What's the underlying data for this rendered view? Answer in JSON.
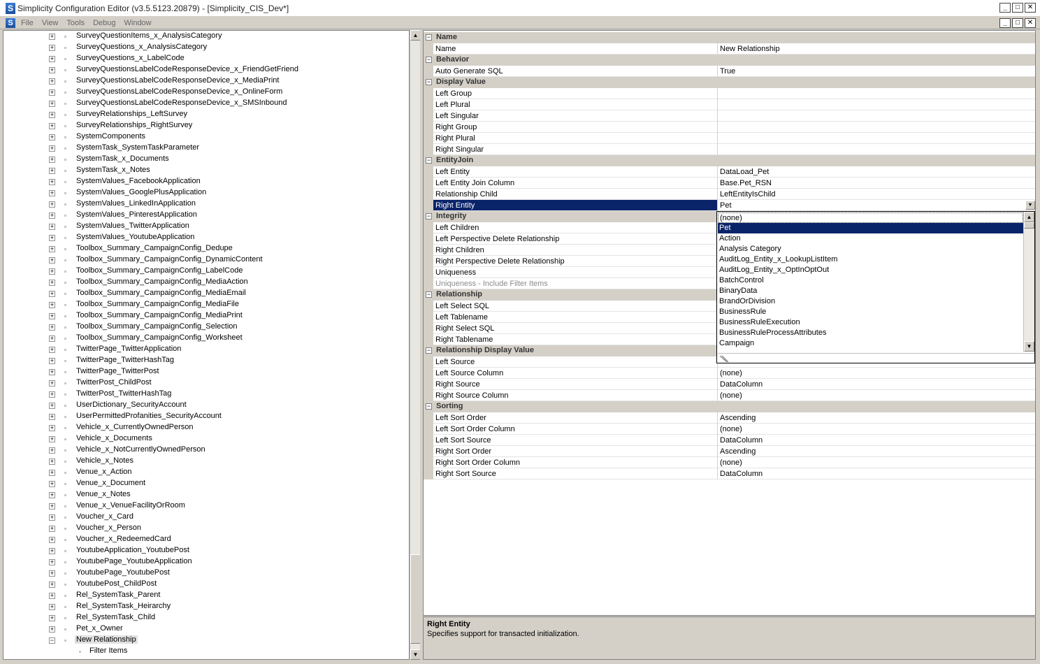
{
  "window": {
    "title": "Simplicity Configuration Editor (v3.5.5123.20879) - [Simplicity_CIS_Dev*]",
    "app_icon_letter": "S",
    "buttons": {
      "minimize": "_",
      "restore": "□",
      "close": "✕"
    }
  },
  "menubar": {
    "items": [
      "File",
      "View",
      "Tools",
      "Debug",
      "Window"
    ]
  },
  "tree": {
    "items": [
      "SurveyQuestionItems_x_AnalysisCategory",
      "SurveyQuestions_x_AnalysisCategory",
      "SurveyQuestions_x_LabelCode",
      "SurveyQuestionsLabelCodeResponseDevice_x_FriendGetFriend",
      "SurveyQuestionsLabelCodeResponseDevice_x_MediaPrint",
      "SurveyQuestionsLabelCodeResponseDevice_x_OnlineForm",
      "SurveyQuestionsLabelCodeResponseDevice_x_SMSInbound",
      "SurveyRelationships_LeftSurvey",
      "SurveyRelationships_RightSurvey",
      "SystemComponents",
      "SystemTask_SystemTaskParameter",
      "SystemTask_x_Documents",
      "SystemTask_x_Notes",
      "SystemValues_FacebookApplication",
      "SystemValues_GooglePlusApplication",
      "SystemValues_LinkedInApplication",
      "SystemValues_PinterestApplication",
      "SystemValues_TwitterApplication",
      "SystemValues_YoutubeApplication",
      "Toolbox_Summary_CampaignConfig_Dedupe",
      "Toolbox_Summary_CampaignConfig_DynamicContent",
      "Toolbox_Summary_CampaignConfig_LabelCode",
      "Toolbox_Summary_CampaignConfig_MediaAction",
      "Toolbox_Summary_CampaignConfig_MediaEmail",
      "Toolbox_Summary_CampaignConfig_MediaFile",
      "Toolbox_Summary_CampaignConfig_MediaPrint",
      "Toolbox_Summary_CampaignConfig_Selection",
      "Toolbox_Summary_CampaignConfig_Worksheet",
      "TwitterPage_TwitterApplication",
      "TwitterPage_TwitterHashTag",
      "TwitterPage_TwitterPost",
      "TwitterPost_ChildPost",
      "TwitterPost_TwitterHashTag",
      "UserDictionary_SecurityAccount",
      "UserPermittedProfanities_SecurityAccount",
      "Vehicle_x_CurrentlyOwnedPerson",
      "Vehicle_x_Documents",
      "Vehicle_x_NotCurrentlyOwnedPerson",
      "Vehicle_x_Notes",
      "Venue_x_Action",
      "Venue_x_Document",
      "Venue_x_Notes",
      "Venue_x_VenueFacilityOrRoom",
      "Voucher_x_Card",
      "Voucher_x_Person",
      "Voucher_x_RedeemedCard",
      "YoutubeApplication_YoutubePost",
      "YoutubePage_YoutubeApplication",
      "YoutubePage_YoutubePost",
      "YoutubePost_ChildPost",
      "Rel_SystemTask_Parent",
      "Rel_SystemTask_Heirarchy",
      "Rel_SystemTask_Child",
      "Pet_x_Owner",
      "New Relationship"
    ],
    "child_item": "Filter Items"
  },
  "propertygrid": {
    "rows": [
      {
        "kind": "cat",
        "label": "Name"
      },
      {
        "kind": "prop",
        "name": "Name",
        "value": "New Relationship"
      },
      {
        "kind": "cat",
        "label": "Behavior"
      },
      {
        "kind": "prop",
        "name": "Auto Generate SQL",
        "value": "True"
      },
      {
        "kind": "cat",
        "label": "Display Value"
      },
      {
        "kind": "prop",
        "name": "Left Group",
        "value": ""
      },
      {
        "kind": "prop",
        "name": "Left Plural",
        "value": ""
      },
      {
        "kind": "prop",
        "name": "Left Singular",
        "value": ""
      },
      {
        "kind": "prop",
        "name": "Right Group",
        "value": ""
      },
      {
        "kind": "prop",
        "name": "Right Plural",
        "value": ""
      },
      {
        "kind": "prop",
        "name": "Right Singular",
        "value": ""
      },
      {
        "kind": "cat",
        "label": "EntityJoin"
      },
      {
        "kind": "prop",
        "name": "Left Entity",
        "value": "DataLoad_Pet"
      },
      {
        "kind": "prop",
        "name": "Left Entity Join Column",
        "value": "Base.Pet_RSN"
      },
      {
        "kind": "prop",
        "name": "Relationship Child",
        "value": "LeftEntityIsChild"
      },
      {
        "kind": "prop",
        "name": "Right Entity",
        "value": "Pet",
        "selected": true
      },
      {
        "kind": "cat",
        "label": "Integrity"
      },
      {
        "kind": "prop",
        "name": "Left Children",
        "value": ""
      },
      {
        "kind": "prop",
        "name": "Left Perspective Delete Relationship",
        "value": ""
      },
      {
        "kind": "prop",
        "name": "Right Children",
        "value": ""
      },
      {
        "kind": "prop",
        "name": "Right Perspective Delete Relationship",
        "value": ""
      },
      {
        "kind": "prop",
        "name": "Uniqueness",
        "value": ""
      },
      {
        "kind": "prop",
        "name": "Uniqueness - Include Filter Items",
        "value": "",
        "disabled": true
      },
      {
        "kind": "cat",
        "label": "Relationship"
      },
      {
        "kind": "prop",
        "name": "Left Select SQL",
        "value": ""
      },
      {
        "kind": "prop",
        "name": "Left Tablename",
        "value": ""
      },
      {
        "kind": "prop",
        "name": "Right Select SQL",
        "value": ""
      },
      {
        "kind": "prop",
        "name": "Right Tablename",
        "value": ""
      },
      {
        "kind": "cat",
        "label": "Relationship Display Value"
      },
      {
        "kind": "prop",
        "name": "Left Source",
        "value": ""
      },
      {
        "kind": "prop",
        "name": "Left Source Column",
        "value": "(none)"
      },
      {
        "kind": "prop",
        "name": "Right Source",
        "value": "DataColumn"
      },
      {
        "kind": "prop",
        "name": "Right Source Column",
        "value": "(none)"
      },
      {
        "kind": "cat",
        "label": "Sorting"
      },
      {
        "kind": "prop",
        "name": "Left Sort Order",
        "value": "Ascending"
      },
      {
        "kind": "prop",
        "name": "Left Sort Order Column",
        "value": "(none)"
      },
      {
        "kind": "prop",
        "name": "Left Sort Source",
        "value": "DataColumn"
      },
      {
        "kind": "prop",
        "name": "Right Sort Order",
        "value": "Ascending"
      },
      {
        "kind": "prop",
        "name": "Right Sort Order Column",
        "value": "(none)"
      },
      {
        "kind": "prop",
        "name": "Right Sort Source",
        "value": "DataColumn"
      }
    ]
  },
  "dropdown": {
    "items": [
      "(none)",
      "Pet",
      "Action",
      "Analysis Category",
      "AuditLog_Entity_x_LookupListItem",
      "AuditLog_Entity_x_OptInOptOut",
      "BatchControl",
      "BinaryData",
      "BrandOrDivision",
      "BusinessRule",
      "BusinessRuleExecution",
      "BusinessRuleProcessAttributes",
      "Campaign"
    ],
    "selected_index": 1
  },
  "description": {
    "title": "Right Entity",
    "text": "Specifies support for transacted initialization."
  },
  "colors": {
    "selection": "#0a246a",
    "category_bg": "#d4d0c8"
  }
}
